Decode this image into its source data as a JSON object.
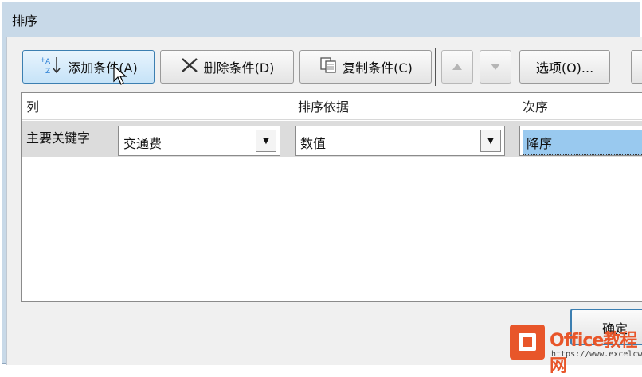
{
  "window": {
    "title": "排序"
  },
  "toolbar": {
    "add_label": "添加条件(A)",
    "delete_label": "删除条件(D)",
    "copy_label": "复制条件(C)",
    "options_label": "选项(O)..."
  },
  "columns": {
    "col": "列",
    "sort_on": "排序依据",
    "order": "次序"
  },
  "rows": [
    {
      "label": "主要关键字",
      "key": "交通费",
      "sort_on": "数值",
      "order": "降序"
    }
  ],
  "footer": {
    "ok_label": "确定"
  },
  "watermark": {
    "brand": "Office教程网",
    "url": "https://www.excelcw.com"
  }
}
